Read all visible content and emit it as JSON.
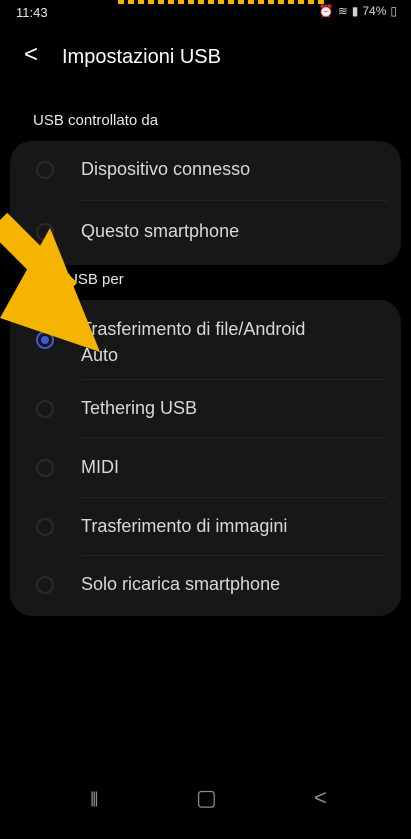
{
  "status_bar": {
    "time": "11:43",
    "battery": "74%",
    "icons": [
      "alarm-icon",
      "wifi-icon",
      "signal-icon",
      "battery-icon"
    ]
  },
  "header": {
    "back_glyph": "<",
    "title": "Impostazioni USB"
  },
  "usb_controlled_by": {
    "heading": "USB controllato da",
    "options": [
      {
        "label": "Dispositivo connesso",
        "selected": false
      },
      {
        "label": "Questo smartphone",
        "selected": false
      }
    ]
  },
  "usb_for": {
    "heading": "USB per",
    "options": [
      {
        "label_line1": "Trasferimento di file/Android",
        "label_line2": "Auto",
        "selected": true
      },
      {
        "label": "Tethering USB",
        "selected": false
      },
      {
        "label": "MIDI",
        "selected": false
      },
      {
        "label": "Trasferimento di immagini",
        "selected": false
      },
      {
        "label": "Solo ricarica smartphone",
        "selected": false
      }
    ]
  },
  "nav_bar": {
    "recents_glyph": "|||",
    "home_glyph": "▢",
    "back_glyph": "<"
  },
  "annotation": {
    "color": "#F4B400"
  },
  "colors": {
    "accent": "#3D5AD6",
    "card": "#171717"
  }
}
